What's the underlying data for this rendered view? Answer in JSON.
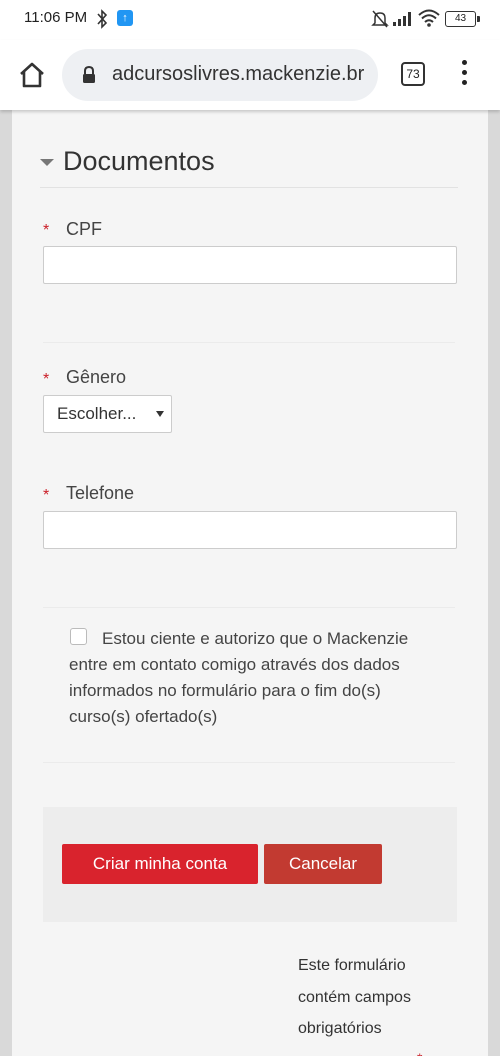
{
  "status_bar": {
    "time": "11:06 PM",
    "battery": "43"
  },
  "browser": {
    "url": "adcursoslivres.mackenzie.br",
    "tab_count": "73"
  },
  "form": {
    "section_title": "Documentos",
    "required_marker": "*",
    "fields": {
      "cpf_label": "CPF",
      "cpf_value": "",
      "genero_label": "Gênero",
      "genero_selected": "Escolher...",
      "telefone_label": "Telefone",
      "telefone_value": ""
    },
    "consent_text": "Estou ciente e autorizo que o Mackenzie entre em contato comigo através dos dados informados no formulário para o fim do(s) curso(s) ofertado(s)",
    "consent_checked": false,
    "buttons": {
      "submit": "Criar minha conta",
      "cancel": "Cancelar"
    },
    "required_note": "Este formulário contém campos obrigatórios"
  },
  "colors": {
    "primary": "#d9232d",
    "cancel": "#c23a31",
    "required": "#ca1e27",
    "status_notification": "#2196f3"
  },
  "icons": [
    "bluetooth-icon",
    "notification-icon",
    "mute-icon",
    "signal-icon",
    "wifi-icon",
    "battery-icon",
    "home-icon",
    "lock-icon",
    "tabs-icon",
    "more-vert-icon",
    "collapse-arrow-icon",
    "dropdown-arrow-icon"
  ]
}
